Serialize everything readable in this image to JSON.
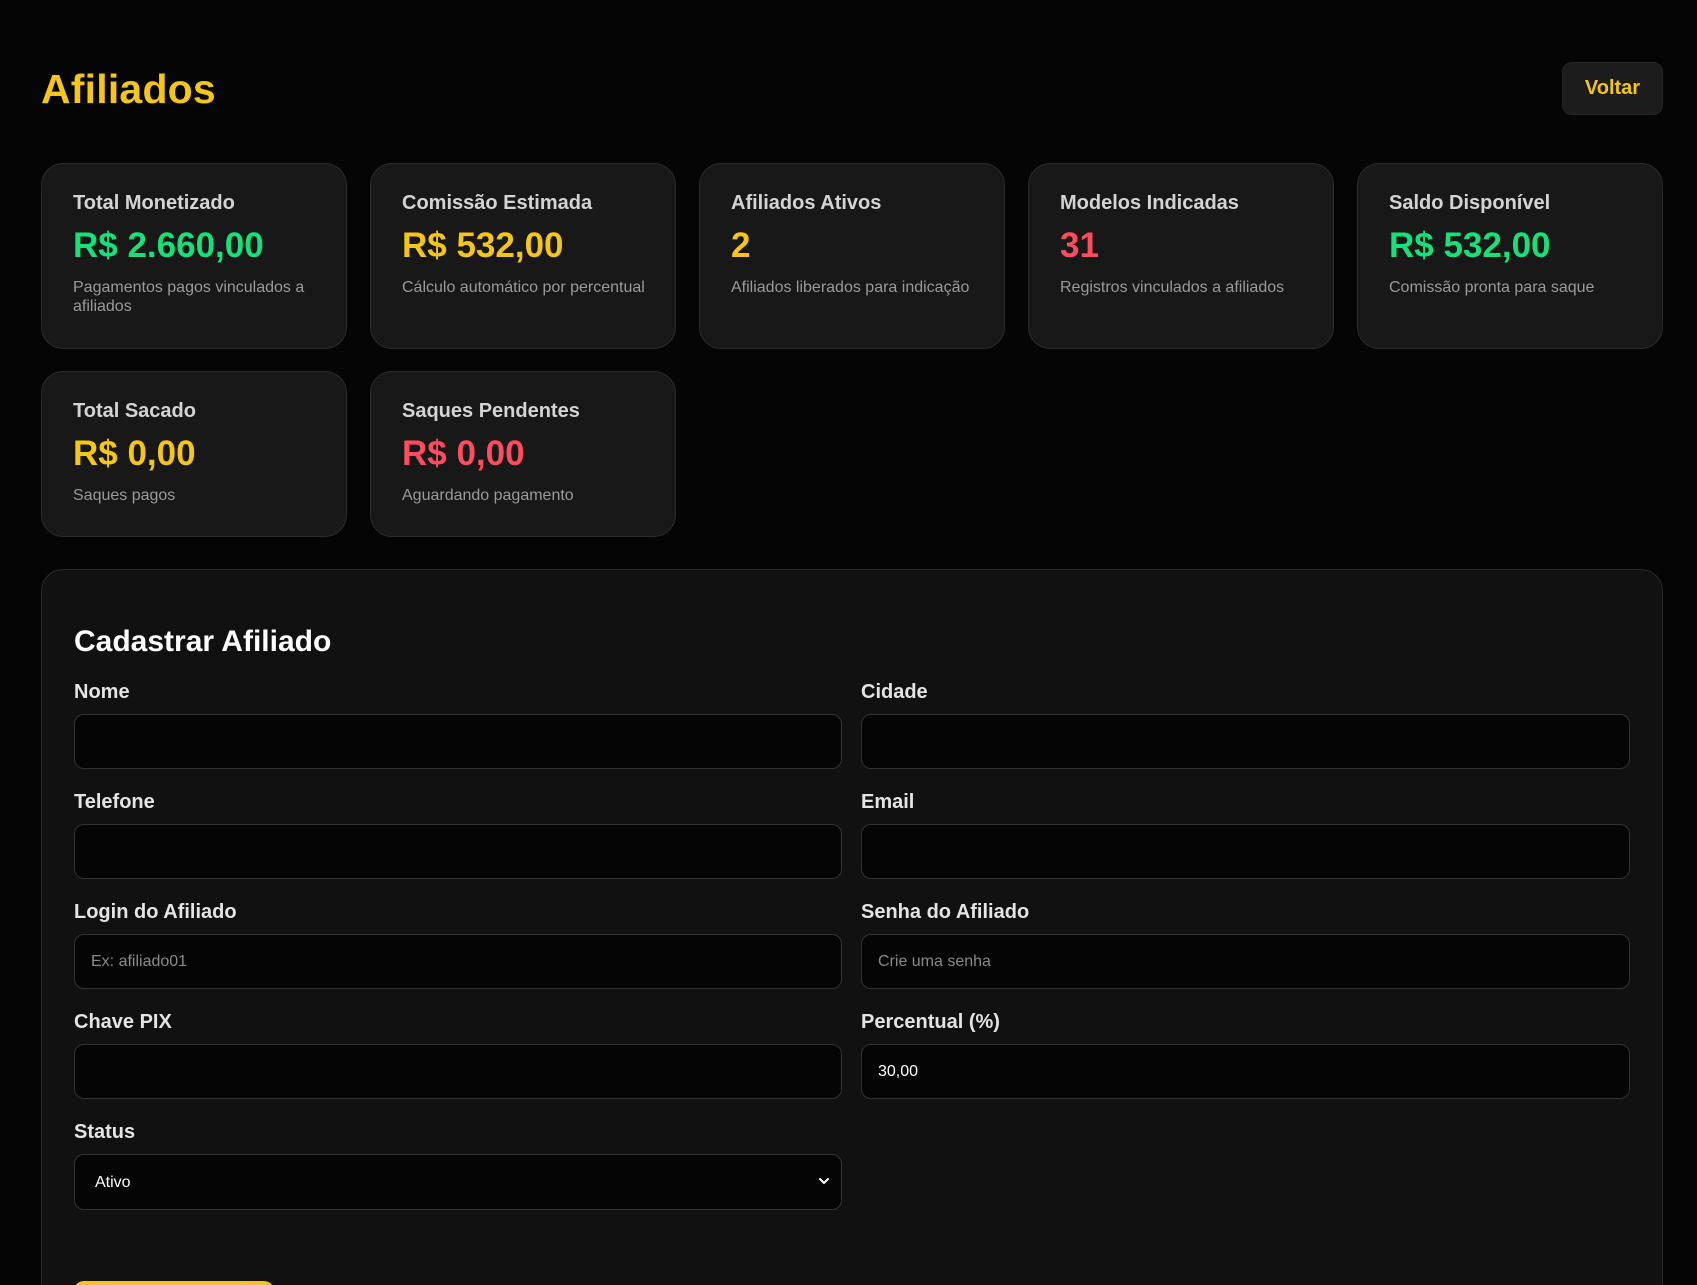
{
  "header": {
    "title": "Afiliados",
    "back_label": "Voltar"
  },
  "colors": {
    "accent": "#f5c518",
    "green": "#16e07a",
    "red": "#ff4d5e"
  },
  "stats": [
    {
      "label": "Total Monetizado",
      "value": "R$ 2.660,00",
      "desc": "Pagamentos pagos vinculados a afiliados",
      "color": "#16e07a"
    },
    {
      "label": "Comissão Estimada",
      "value": "R$ 532,00",
      "desc": "Cálculo automático por percentual",
      "color": "#f5c518"
    },
    {
      "label": "Afiliados Ativos",
      "value": "2",
      "desc": "Afiliados liberados para indicação",
      "color": "#f5c518"
    },
    {
      "label": "Modelos Indicadas",
      "value": "31",
      "desc": "Registros vinculados a afiliados",
      "color": "#ff4d5e"
    },
    {
      "label": "Saldo Disponível",
      "value": "R$ 532,00",
      "desc": "Comissão pronta para saque",
      "color": "#16e07a"
    },
    {
      "label": "Total Sacado",
      "value": "R$ 0,00",
      "desc": "Saques pagos",
      "color": "#f5c518"
    },
    {
      "label": "Saques Pendentes",
      "value": "R$ 0,00",
      "desc": "Aguardando pagamento",
      "color": "#ff4d5e"
    }
  ],
  "form": {
    "title": "Cadastrar Afiliado",
    "fields": {
      "nome": {
        "label": "Nome",
        "value": "",
        "placeholder": ""
      },
      "cidade": {
        "label": "Cidade",
        "value": "",
        "placeholder": ""
      },
      "telefone": {
        "label": "Telefone",
        "value": "",
        "placeholder": ""
      },
      "email": {
        "label": "Email",
        "value": "",
        "placeholder": ""
      },
      "login": {
        "label": "Login do Afiliado",
        "value": "",
        "placeholder": "Ex: afiliado01"
      },
      "senha": {
        "label": "Senha do Afiliado",
        "value": "",
        "placeholder": "Crie uma senha"
      },
      "pix": {
        "label": "Chave PIX",
        "value": "",
        "placeholder": ""
      },
      "percentual": {
        "label": "Percentual (%)",
        "value": "30,00",
        "placeholder": ""
      },
      "status": {
        "label": "Status",
        "value": "Ativo"
      }
    }
  }
}
